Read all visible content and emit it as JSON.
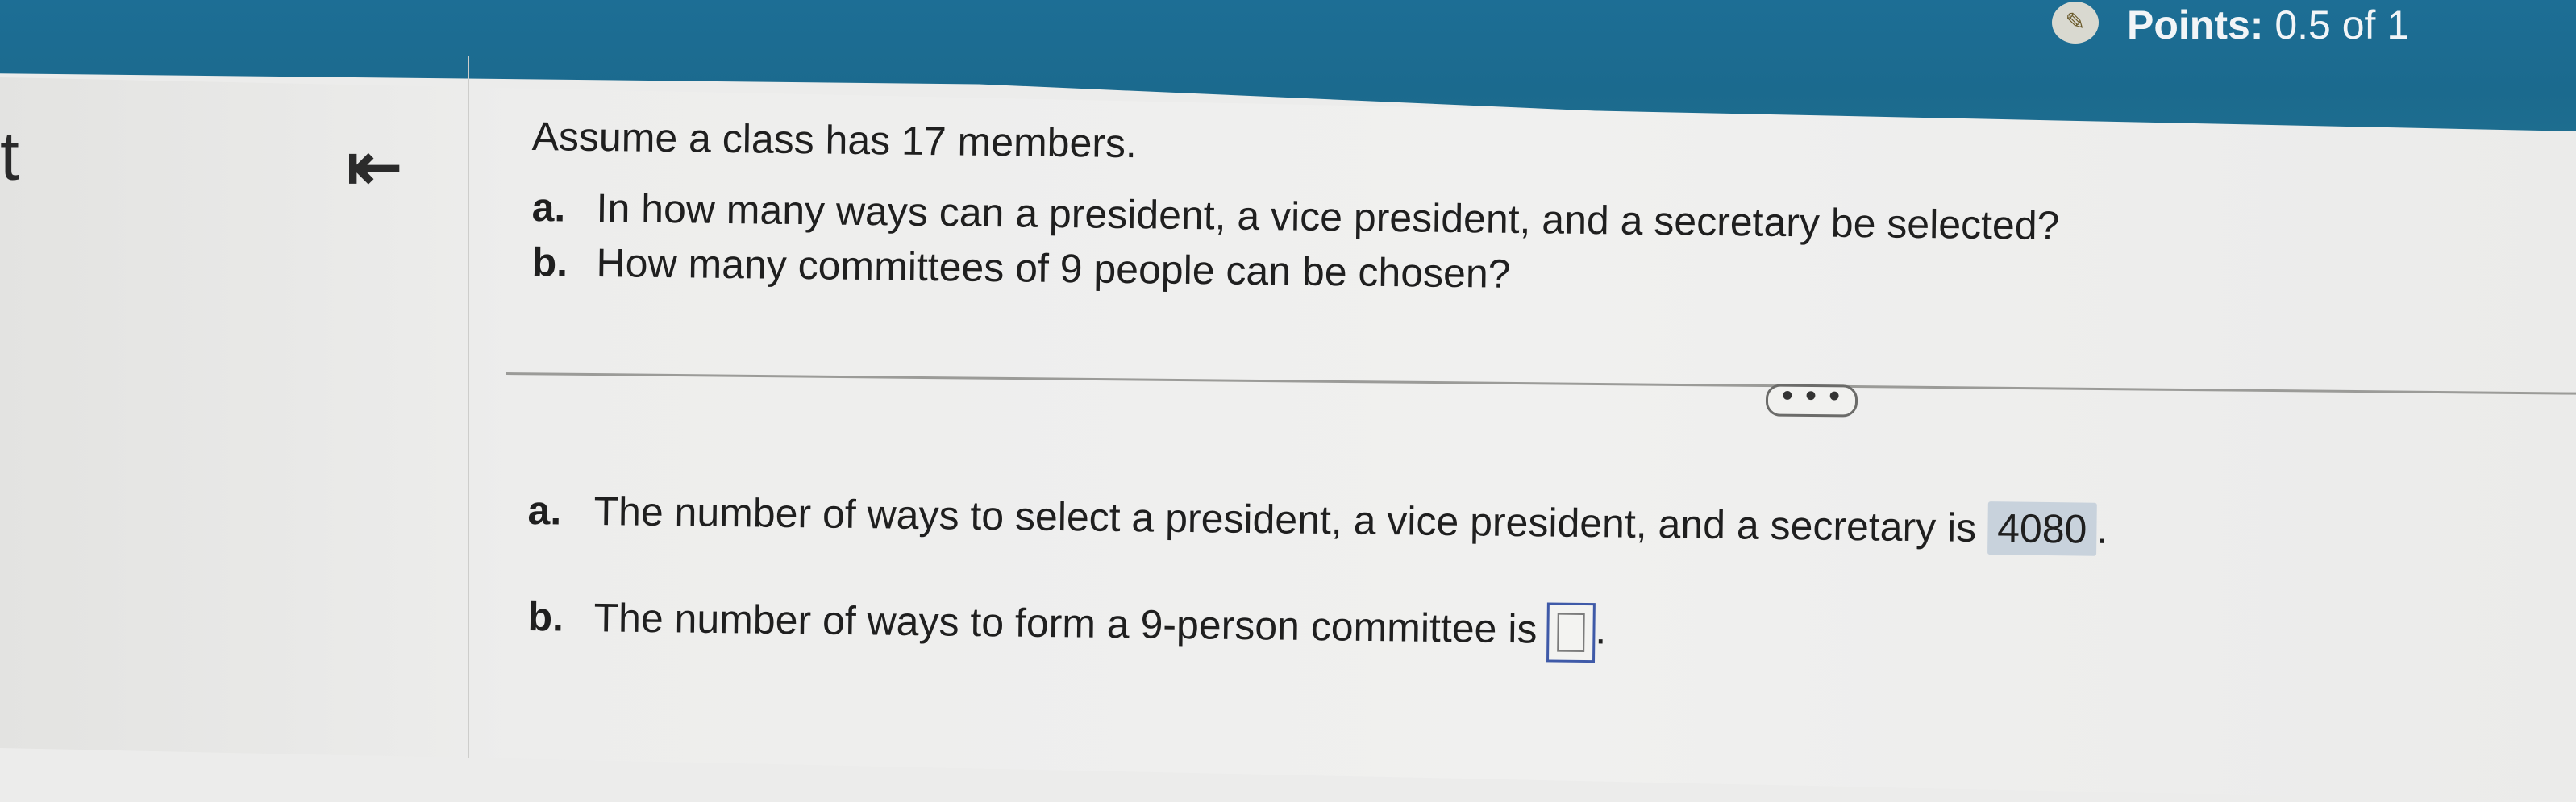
{
  "header": {
    "points_label": "Points:",
    "points_value": "0.5 of 1",
    "points_icon": "partial-credit-icon"
  },
  "nav": {
    "edge_text": "t",
    "collapse_icon": "collapse-left-arrow-icon",
    "collapse_glyph": "⇤",
    "more_label": "• • •"
  },
  "question": {
    "intro": "Assume a class has 17 members.",
    "parts": [
      {
        "letter": "a.",
        "text": "In how many ways can a president, a vice president, and a secretary be selected?"
      },
      {
        "letter": "b.",
        "text": "How many committees of 9 people can be chosen?"
      }
    ]
  },
  "answers": {
    "a": {
      "letter": "a.",
      "text": "The number of ways to select a president, a vice president, and a secretary is",
      "value": "4080",
      "end": "."
    },
    "b": {
      "letter": "b.",
      "text": "The number of ways to form a 9-person committee is",
      "value": "",
      "end": "."
    }
  }
}
